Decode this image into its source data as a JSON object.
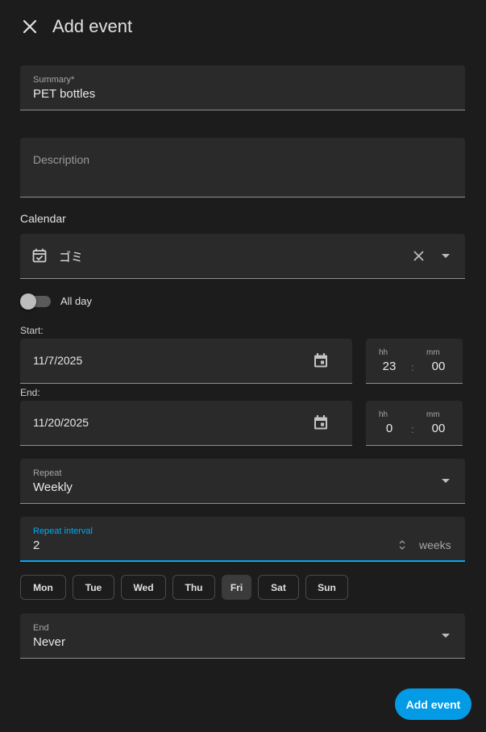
{
  "dialog": {
    "title": "Add event",
    "close_icon": "close-icon"
  },
  "summary": {
    "label": "Summary*",
    "value": "PET bottles"
  },
  "description": {
    "placeholder": "Description"
  },
  "calendar": {
    "section_label": "Calendar",
    "icon": "calendar-check-icon",
    "value": "ゴミ",
    "clear_icon": "clear-icon",
    "dropdown_icon": "dropdown-arrow-icon"
  },
  "all_day": {
    "label": "All day",
    "checked": false
  },
  "start": {
    "label": "Start:",
    "date": "11/7/2025",
    "hh_label": "hh",
    "hh": "23",
    "mm_label": "mm",
    "mm": "00",
    "separator": ":"
  },
  "end": {
    "label": "End:",
    "date": "11/20/2025",
    "hh_label": "hh",
    "hh": "0",
    "mm_label": "mm",
    "mm": "00",
    "separator": ":"
  },
  "repeat": {
    "label": "Repeat",
    "value": "Weekly"
  },
  "repeat_interval": {
    "label": "Repeat interval",
    "value": "2",
    "suffix": "weeks"
  },
  "weekdays": [
    {
      "label": "Mon",
      "selected": false
    },
    {
      "label": "Tue",
      "selected": false
    },
    {
      "label": "Wed",
      "selected": false
    },
    {
      "label": "Thu",
      "selected": false
    },
    {
      "label": "Fri",
      "selected": true
    },
    {
      "label": "Sat",
      "selected": false
    },
    {
      "label": "Sun",
      "selected": false
    }
  ],
  "end_rule": {
    "label": "End",
    "value": "Never"
  },
  "actions": {
    "submit_label": "Add event"
  },
  "colors": {
    "accent": "#03a9f4",
    "button": "#039be5",
    "surface": "#2a2a2a",
    "background": "#1c1c1c"
  }
}
